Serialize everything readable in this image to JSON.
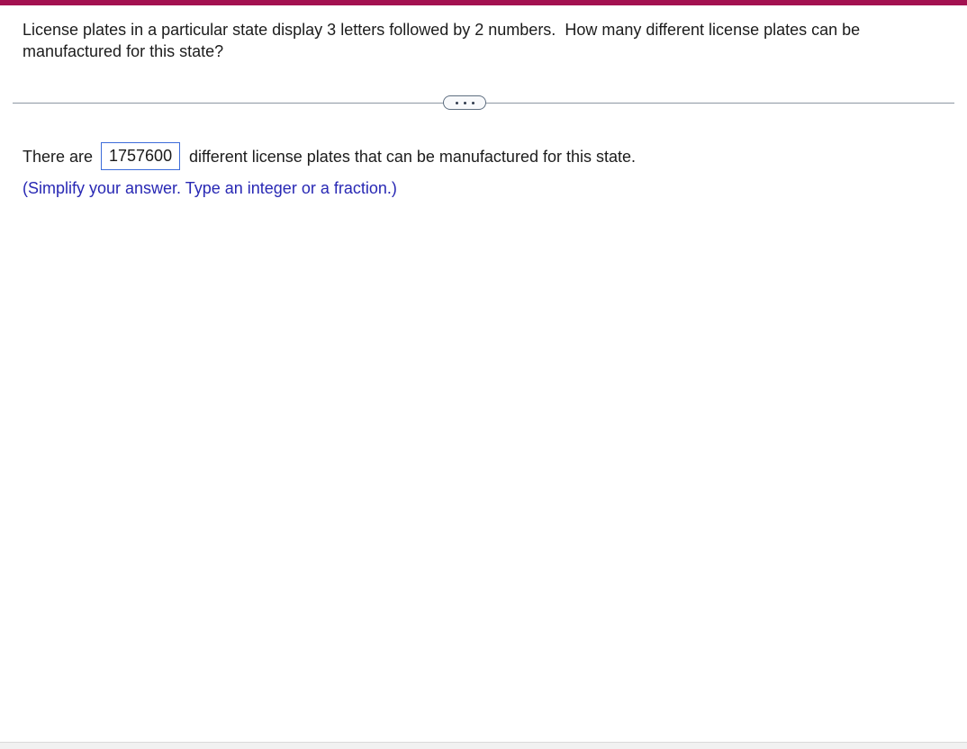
{
  "question": {
    "text": "License plates in a particular state display 3 letters followed by 2 numbers.  How many different license plates can be manufactured for this state?"
  },
  "divider": {
    "ellipsis_icon": "•••"
  },
  "answer": {
    "prefix": "There are",
    "input_value": "1757600",
    "suffix": "different license plates that can be manufactured for this state.",
    "instruction": "(Simplify your answer. Type an integer or a fraction.)"
  },
  "colors": {
    "accent_bar": "#a31150",
    "divider_line": "#8d97a3",
    "pill_border": "#5e6e80",
    "pill_background": "#f8f9fb",
    "pill_dots": "#313c4e",
    "input_border": "#3d6cd9",
    "instruction_text": "#2828b4",
    "body_text": "#1c1c1c",
    "scrollbar_track": "#f1f1f1"
  }
}
